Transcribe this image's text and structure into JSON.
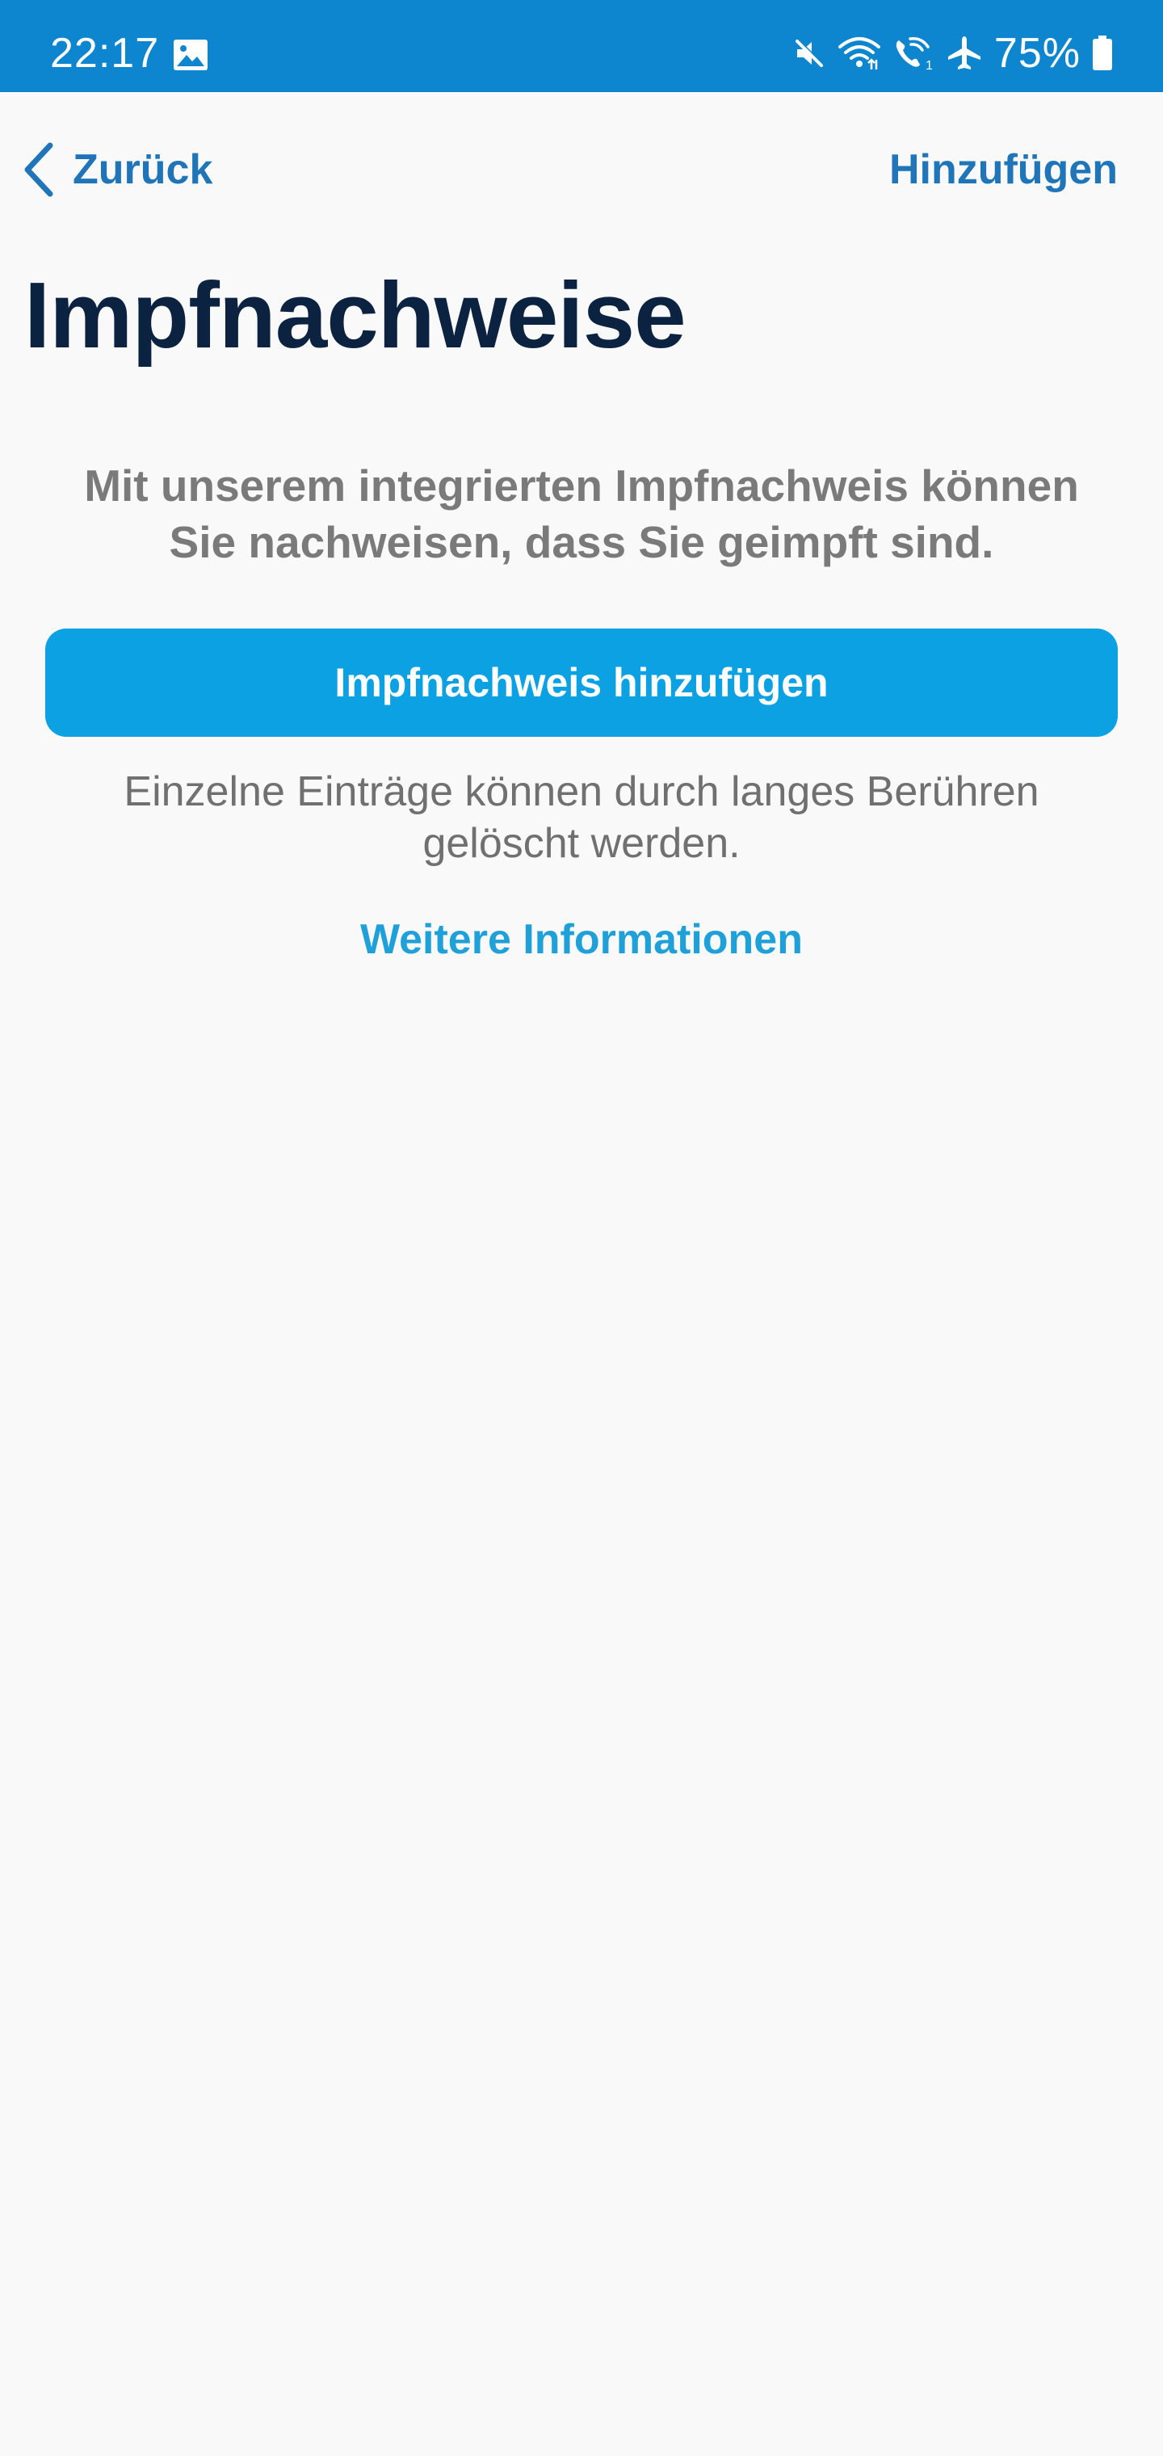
{
  "status_bar": {
    "time": "22:17",
    "battery": "75%",
    "background_color": "#0d85cf",
    "icons": [
      "gallery-icon",
      "mute-icon",
      "wifi-icon",
      "wifi-calling-icon",
      "airplane-icon",
      "battery-icon"
    ]
  },
  "nav": {
    "back_label": "Zurück",
    "add_label": "Hinzufügen",
    "accent_color": "#1f75b7"
  },
  "page": {
    "title": "Impfnachweise",
    "intro": "Mit unserem integrierten Impfnachweis können Sie nachweisen, dass Sie geimpft sind.",
    "primary_button_label": "Impfnachweis hinzufügen",
    "primary_button_color": "#0ca1e3",
    "hint": "Einzelne Einträge können durch langes Berühren gelöscht werden.",
    "info_link": "Weitere Informationen"
  }
}
